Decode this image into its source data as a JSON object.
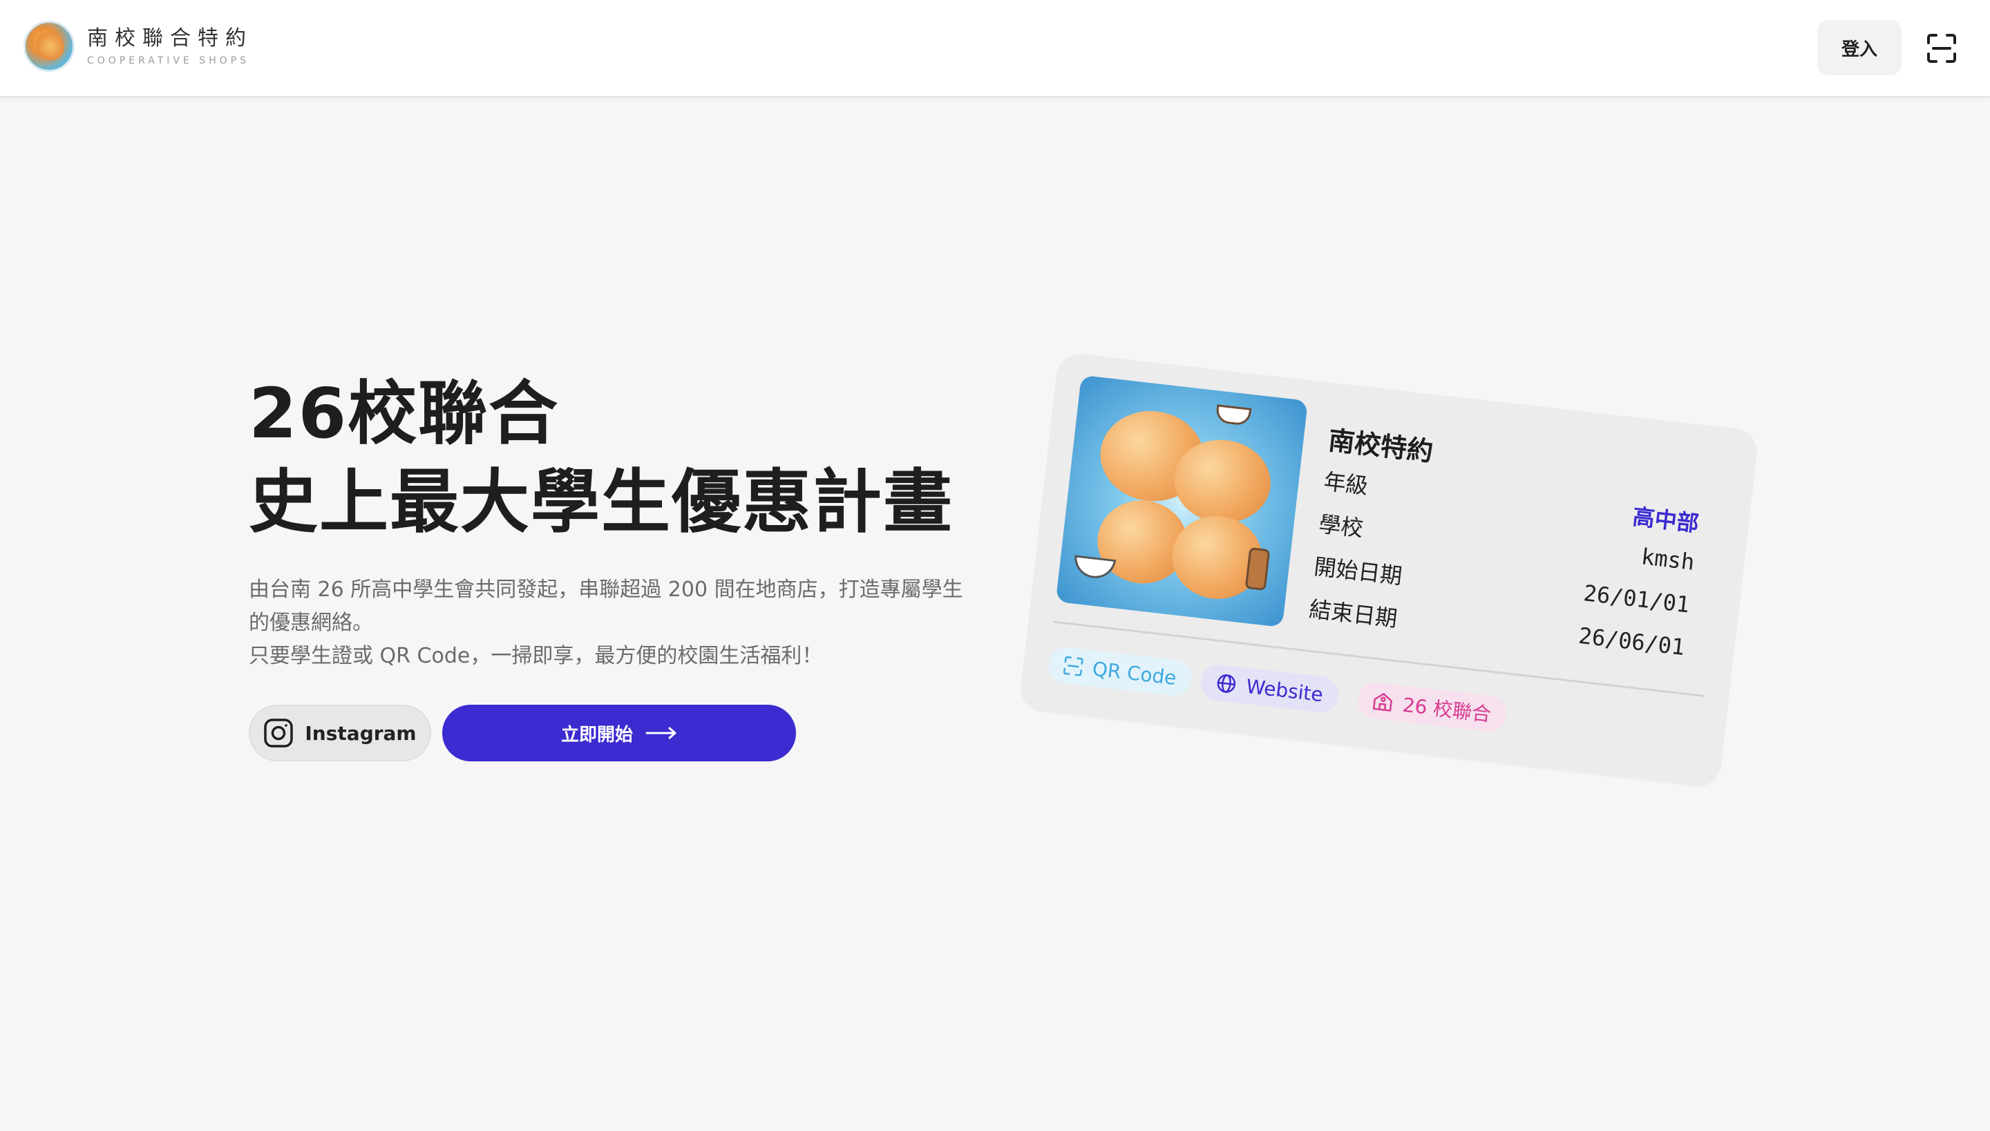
{
  "header": {
    "brand_title": "南校聯合特約",
    "brand_subtitle": "COOPERATIVE SHOPS",
    "login_label": "登入",
    "scan_icon": "scan-icon"
  },
  "hero": {
    "headline_line1": "26校聯合",
    "headline_line2": "史上最大學生優惠計畫",
    "description_line1": "由台南 26 所高中學生會共同發起，串聯超過 200 間在地商店，打造專屬學生的優惠網絡。",
    "description_line2": "只要學生證或 QR Code，一掃即享，最方便的校園生活福利！",
    "instagram_label": "Instagram",
    "start_label": "立即開始"
  },
  "card": {
    "title": "南校特約",
    "fields": [
      {
        "label": "年級",
        "value": "高中部"
      },
      {
        "label": "學校",
        "value": "kmsh"
      },
      {
        "label": "開始日期",
        "value": "26/01/01"
      },
      {
        "label": "結束日期",
        "value": "26/06/01"
      }
    ],
    "chips": [
      {
        "label": "QR Code",
        "icon": "qr-scan-icon"
      },
      {
        "label": "Website",
        "icon": "globe-icon"
      },
      {
        "label": "26 校聯合",
        "icon": "school-icon"
      }
    ]
  },
  "colors": {
    "accent": "#3b2bd0",
    "background": "#f6f6f6",
    "chip_qr": "#3fa8df",
    "chip_website": "#3b2bd0",
    "chip_26": "#d83a91"
  }
}
